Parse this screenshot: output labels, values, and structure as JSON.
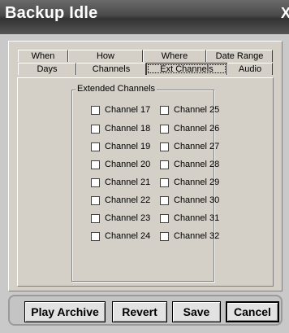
{
  "window": {
    "title": "Backup Idle",
    "close_label": "X"
  },
  "tabs": {
    "back_row": [
      {
        "label": "When"
      },
      {
        "label": "How"
      },
      {
        "label": "Where"
      },
      {
        "label": "Date Range"
      }
    ],
    "front_row": [
      {
        "label": "Days"
      },
      {
        "label": "Channels"
      },
      {
        "label": "Ext Channels"
      },
      {
        "label": "Audio"
      }
    ],
    "active": "Ext Channels"
  },
  "group": {
    "label": "Extended Channels",
    "channels_left": [
      "Channel 17",
      "Channel 18",
      "Channel 19",
      "Channel 20",
      "Channel 21",
      "Channel 22",
      "Channel 23",
      "Channel 24"
    ],
    "channels_right": [
      "Channel 25",
      "Channel 26",
      "Channel 27",
      "Channel 28",
      "Channel 29",
      "Channel 30",
      "Channel 31",
      "Channel 32"
    ]
  },
  "buttons": {
    "play_archive": "Play Archive",
    "revert": "Revert",
    "save": "Save",
    "cancel": "Cancel"
  }
}
